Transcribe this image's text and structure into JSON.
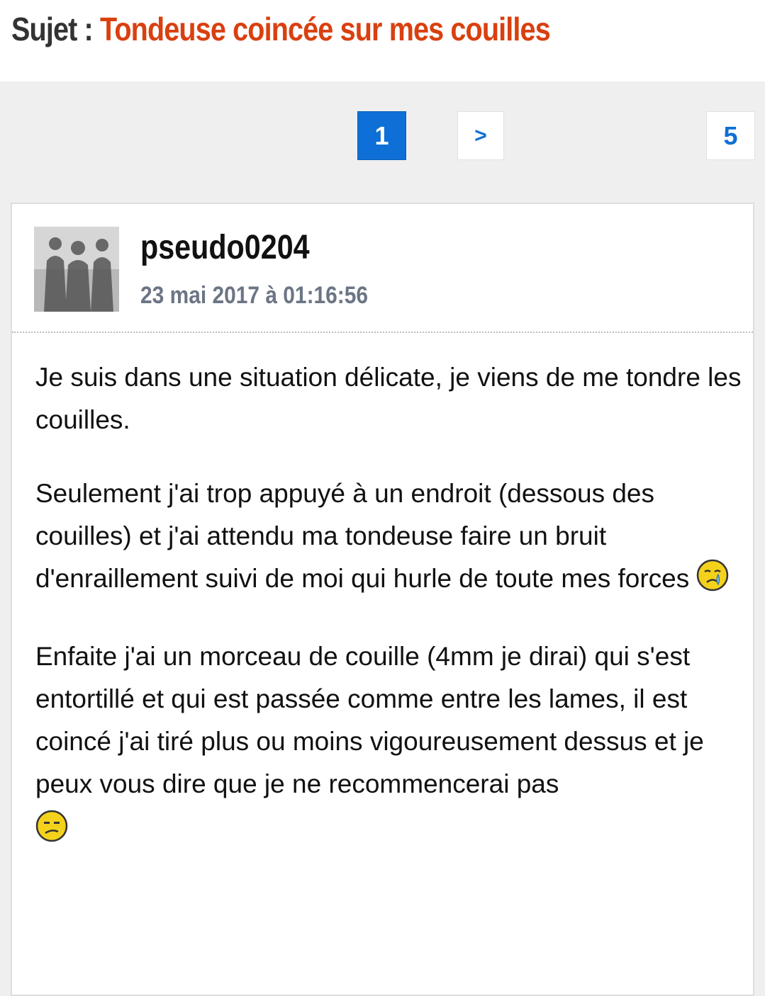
{
  "header": {
    "subject_prefix": "Sujet :",
    "subject_title": "Tondeuse coincée sur mes couilles"
  },
  "pagination": {
    "current": "1",
    "next": ">",
    "last": "5"
  },
  "post": {
    "author": "pseudo0204",
    "date": "23 mai 2017 à 01:16:56",
    "paragraphs": [
      "Je suis dans une situation délicate, je viens de me tondre les couilles.",
      "Seulement j'ai trop appuyé à un endroit (dessous des couilles) et j'ai attendu ma tondeuse faire un bruit d'enraillement suivi de moi qui hurle de toute mes forces",
      "Enfaite j'ai un morceau de couille (4mm je dirai) qui s'est entortillé et qui est passée comme entre les lames, il est coincé j'ai tiré plus ou moins vigoureusement dessus et je peux vous dire que je ne recommencerai pas"
    ],
    "smileys": [
      "crying-smiley-icon",
      "sad-smiley-icon"
    ]
  },
  "colors": {
    "title_accent": "#d9400f",
    "pager_blue": "#0e6fd6",
    "date_gray": "#6b7585",
    "page_bg": "#efefef"
  }
}
